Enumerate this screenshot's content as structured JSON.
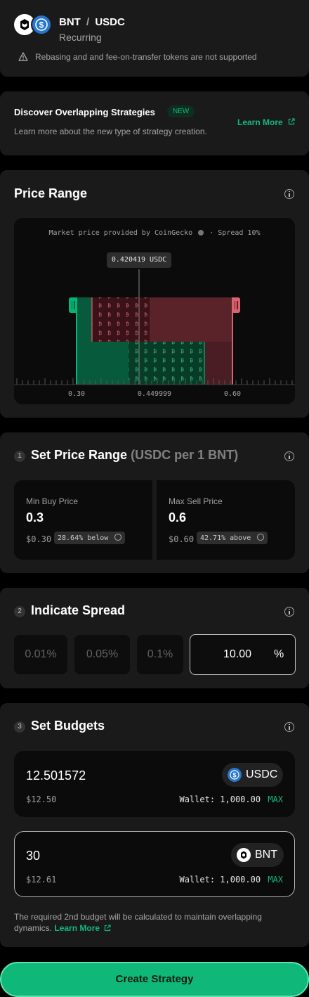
{
  "pair": {
    "base": "BNT",
    "separator": "/",
    "quote": "USDC",
    "type": "Recurring",
    "warning": "Rebasing and and fee-on-transfer tokens are not supported"
  },
  "discover": {
    "title": "Discover Overlapping Strategies",
    "badge": "NEW",
    "description": "Learn more about the new type of strategy creation.",
    "learn_more": "Learn More"
  },
  "price_range": {
    "title": "Price Range",
    "market_note": "Market price provided by CoinGecko",
    "spread_note": "· Spread 10%",
    "marker": "0.420419 USDC",
    "ticks": [
      "0.30",
      "0.449999",
      "0.60"
    ]
  },
  "chart_data": {
    "type": "area",
    "market_price": 0.420419,
    "buy_range": [
      0.3,
      0.449999
    ],
    "sell_range": [
      0.449999,
      0.6
    ],
    "tick_labels": [
      "0.30",
      "0.449999",
      "0.60"
    ],
    "colors": {
      "buy": "#00b578",
      "sell": "#d86371"
    }
  },
  "set_price_range": {
    "step": "1",
    "title": "Set Price Range",
    "unit": "(USDC per 1 BNT)",
    "min": {
      "label": "Min Buy Price",
      "value": "0.3",
      "usd": "$0.30",
      "badge": "28.64% below"
    },
    "max": {
      "label": "Max Sell Price",
      "value": "0.6",
      "usd": "$0.60",
      "badge": "42.71% above"
    }
  },
  "spread": {
    "step": "2",
    "title": "Indicate Spread",
    "options": [
      "0.01%",
      "0.05%",
      "0.1%"
    ],
    "value": "10.00",
    "unit": "%"
  },
  "budgets": {
    "step": "3",
    "title": "Set Budgets",
    "quote": {
      "amount": "12.501572",
      "token": "USDC",
      "usd": "$12.50",
      "wallet": "Wallet: 1,000.00",
      "max": "MAX"
    },
    "base": {
      "amount": "30",
      "token": "BNT",
      "usd": "$12.61",
      "wallet": "Wallet: 1,000.00",
      "max": "MAX"
    },
    "note": "The required 2nd budget will be calculated to maintain overlapping dynamics.",
    "learn_more": "Learn More"
  },
  "submit": {
    "label": "Create Strategy"
  },
  "colors": {
    "accent": "#10b981",
    "buy": "#00b578",
    "sell": "#d86371",
    "card": "#1a1a1a",
    "usdc": "#2775ca"
  }
}
